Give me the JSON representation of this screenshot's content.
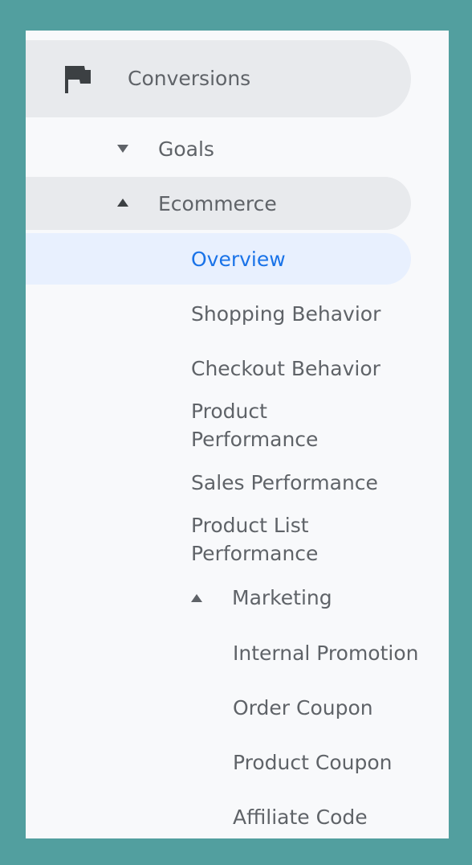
{
  "nav": {
    "conversions": {
      "label": "Conversions",
      "icon": "flag-icon"
    },
    "goals": {
      "label": "Goals",
      "icon": "arrow-down-icon"
    },
    "ecommerce": {
      "label": "Ecommerce",
      "icon": "arrow-up-icon",
      "items": [
        {
          "label": "Overview",
          "active": true
        },
        {
          "label": "Shopping Behavior"
        },
        {
          "label": "Checkout Behavior"
        },
        {
          "label": "Product Performance"
        },
        {
          "label": "Sales Performance"
        },
        {
          "label": "Product List Performance"
        }
      ]
    },
    "marketing": {
      "label": "Marketing",
      "icon": "arrow-up-icon",
      "items": [
        {
          "label": "Internal Promotion"
        },
        {
          "label": "Order Coupon"
        },
        {
          "label": "Product Coupon"
        },
        {
          "label": "Affiliate Code"
        }
      ]
    }
  },
  "colors": {
    "teal_border": "#529f9f",
    "panel": "#f8f9fb",
    "pill_gray": "#e8eaed",
    "pill_active": "#e8f0fe",
    "text": "#5f6368",
    "active_text": "#1a73e8",
    "icon": "#3c4043"
  }
}
